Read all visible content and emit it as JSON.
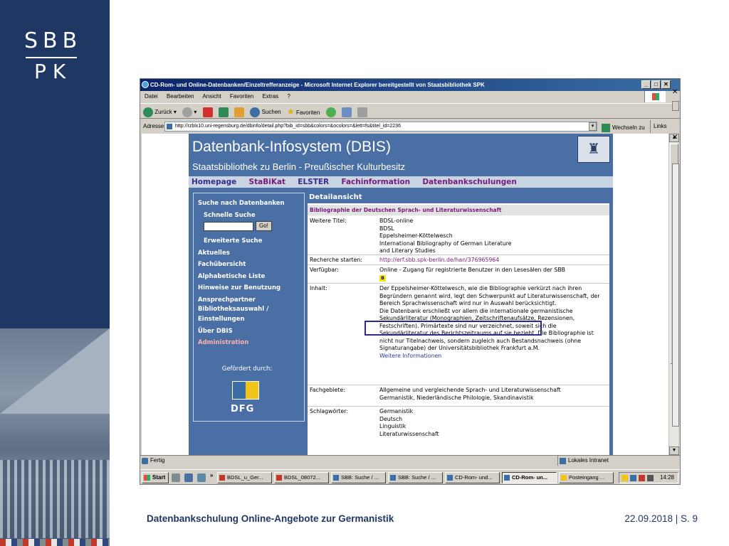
{
  "logo": {
    "top": "SBB",
    "bottom": "PK"
  },
  "footer": {
    "title": "Datenbankschulung Online-Angebote zur Germanistik",
    "date_page": "22.09.2018 | S. 9"
  },
  "browser": {
    "title": "CD-Rom- und Online-Datenbanken/Einzeltrefferanzeige - Microsoft Internet Explorer bereitgestellt von Staatsbibliothek SPK",
    "menu": [
      "Datei",
      "Bearbeiten",
      "Ansicht",
      "Favoriten",
      "Extras",
      "?"
    ],
    "toolbar": {
      "back": "Zurück",
      "search": "Suchen",
      "favorites": "Favoriten"
    },
    "address_label": "Adresse",
    "address_value": "http://rzblx10.uni-regensburg.de/dbinfo/detail.php?bib_id=sbb&colors=&ocolors=&lett=fs&titel_id=2236",
    "go_label": "Wechseln zu",
    "links_label": "Links",
    "status_text": "Fertig",
    "status_zone": "Lokales Intranet"
  },
  "dbis": {
    "title": "Datenbank-Infosystem (DBIS)",
    "subtitle": "Staatsbibliothek zu Berlin - Preußischer Kulturbesitz",
    "nav": [
      "Homepage",
      "StaBiKat",
      "ELSTER",
      "Fachinformation",
      "Datenbankschulungen"
    ],
    "sidebar": {
      "search_head": "Suche nach Datenbanken",
      "quick_search": "Schnelle Suche",
      "go_button": "Go!",
      "advanced_search": "Erweiterte Suche",
      "items": [
        "Aktuelles",
        "Fachübersicht",
        "Alphabetische Liste",
        "Hinweise zur Benutzung",
        "Ansprechpartner",
        "Bibliotheksauswahl /",
        "Einstellungen",
        "Über DBIS"
      ],
      "admin": "Administration",
      "funded_by": "Gefördert durch:",
      "dfg": "DFG"
    },
    "detail": {
      "heading": "Detailansicht",
      "title": "Bibliographie der Deutschen Sprach- und Literaturwissenschaft",
      "other_titles_label": "Weitere Titel:",
      "other_titles": [
        "BDSL-online",
        "BDSL",
        "Eppelsheimer-Köttelwesch",
        "International Bibliography of German Literature",
        "and Literary Studies"
      ],
      "research_label": "Recherche starten:",
      "research_link": "http://erf.sbb.spk-berlin.de/han/376965964",
      "available_label": "Verfügbar:",
      "available_text": "Online - Zugang für registrierte Benutzer in den Lesesälen der SBB",
      "badge": "B",
      "content_label": "Inhalt:",
      "content_p1": "Der Eppelsheimer-Köttelwesch, wie die Bibliographie verkürzt nach ihren Begründern genannt wird, legt den Schwerpunkt auf Literaturwissenschaft, der Bereich Sprachwissenschaft wird nur in Auswahl berücksichtigt.",
      "content_p2": "Die Datenbank erschließt vor allem die internationale germanistische Sekundärliteratur (Monographien, Zeitschriftenaufsätze, Rezensionen, Festschriften). Primärtexte sind nur verzeichnet, soweit sich die Sekundärliteratur des Berichtszeitraums auf sie bezieht. Die Bibliographie ist nicht nur Titelnachweis, sondern zugleich auch Bestandsnachweis (ohne Signaturangabe) der Universitätsbibliothek Frankfurt a.M.",
      "more_info": "Weitere Informationen",
      "subjects_label": "Fachgebiete:",
      "subjects": [
        "Allgemeine und vergleichende Sprach- und Literaturwissenschaft",
        "Germanistik, Niederländische Philologie, Skandinavistik"
      ],
      "keywords_label": "Schlagwörter:",
      "keywords": [
        "Germanistik",
        "Deutsch",
        "Linguistik",
        "Literaturwissenschaft"
      ]
    }
  },
  "taskbar": {
    "start": "Start",
    "chevron": "»",
    "tasks": [
      "BDSL_u_Ger...",
      "BDSL_08072...",
      "SBB: Suche / ...",
      "SBB: Suche / ...",
      "CD-Rom- und...",
      "CD-Rom- un...",
      "Posteingang ..."
    ],
    "clock": "14:28"
  }
}
